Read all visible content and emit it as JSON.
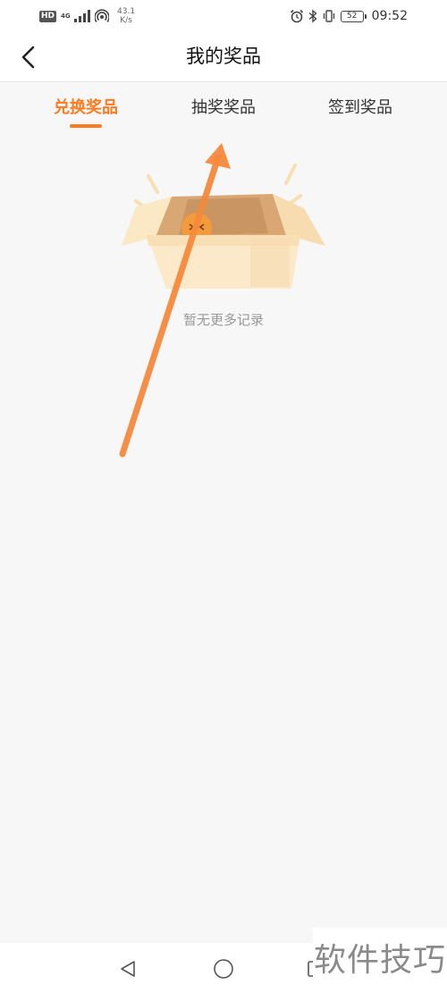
{
  "status_bar": {
    "hd": "HD",
    "network_type": "4G",
    "speed_value": "43.1",
    "speed_unit": "K/s",
    "battery": "52",
    "time": "09:52"
  },
  "header": {
    "title": "我的奖品",
    "back_icon": "chevron-left-icon"
  },
  "tabs": [
    {
      "label": "兑换奖品",
      "active": true
    },
    {
      "label": "抽奖奖品",
      "active": false
    },
    {
      "label": "签到奖品",
      "active": false
    }
  ],
  "empty_state": {
    "message": "暂无更多记录",
    "illustration": "empty-box-icon"
  },
  "nav_bar": {
    "back": "triangle-back-icon",
    "home": "circle-home-icon",
    "recent": "square-recent-icon"
  },
  "watermark": "软件技巧",
  "colors": {
    "accent": "#ff7a1f",
    "annotation_arrow": "#f58a3c",
    "background": "#f7f7f7"
  }
}
